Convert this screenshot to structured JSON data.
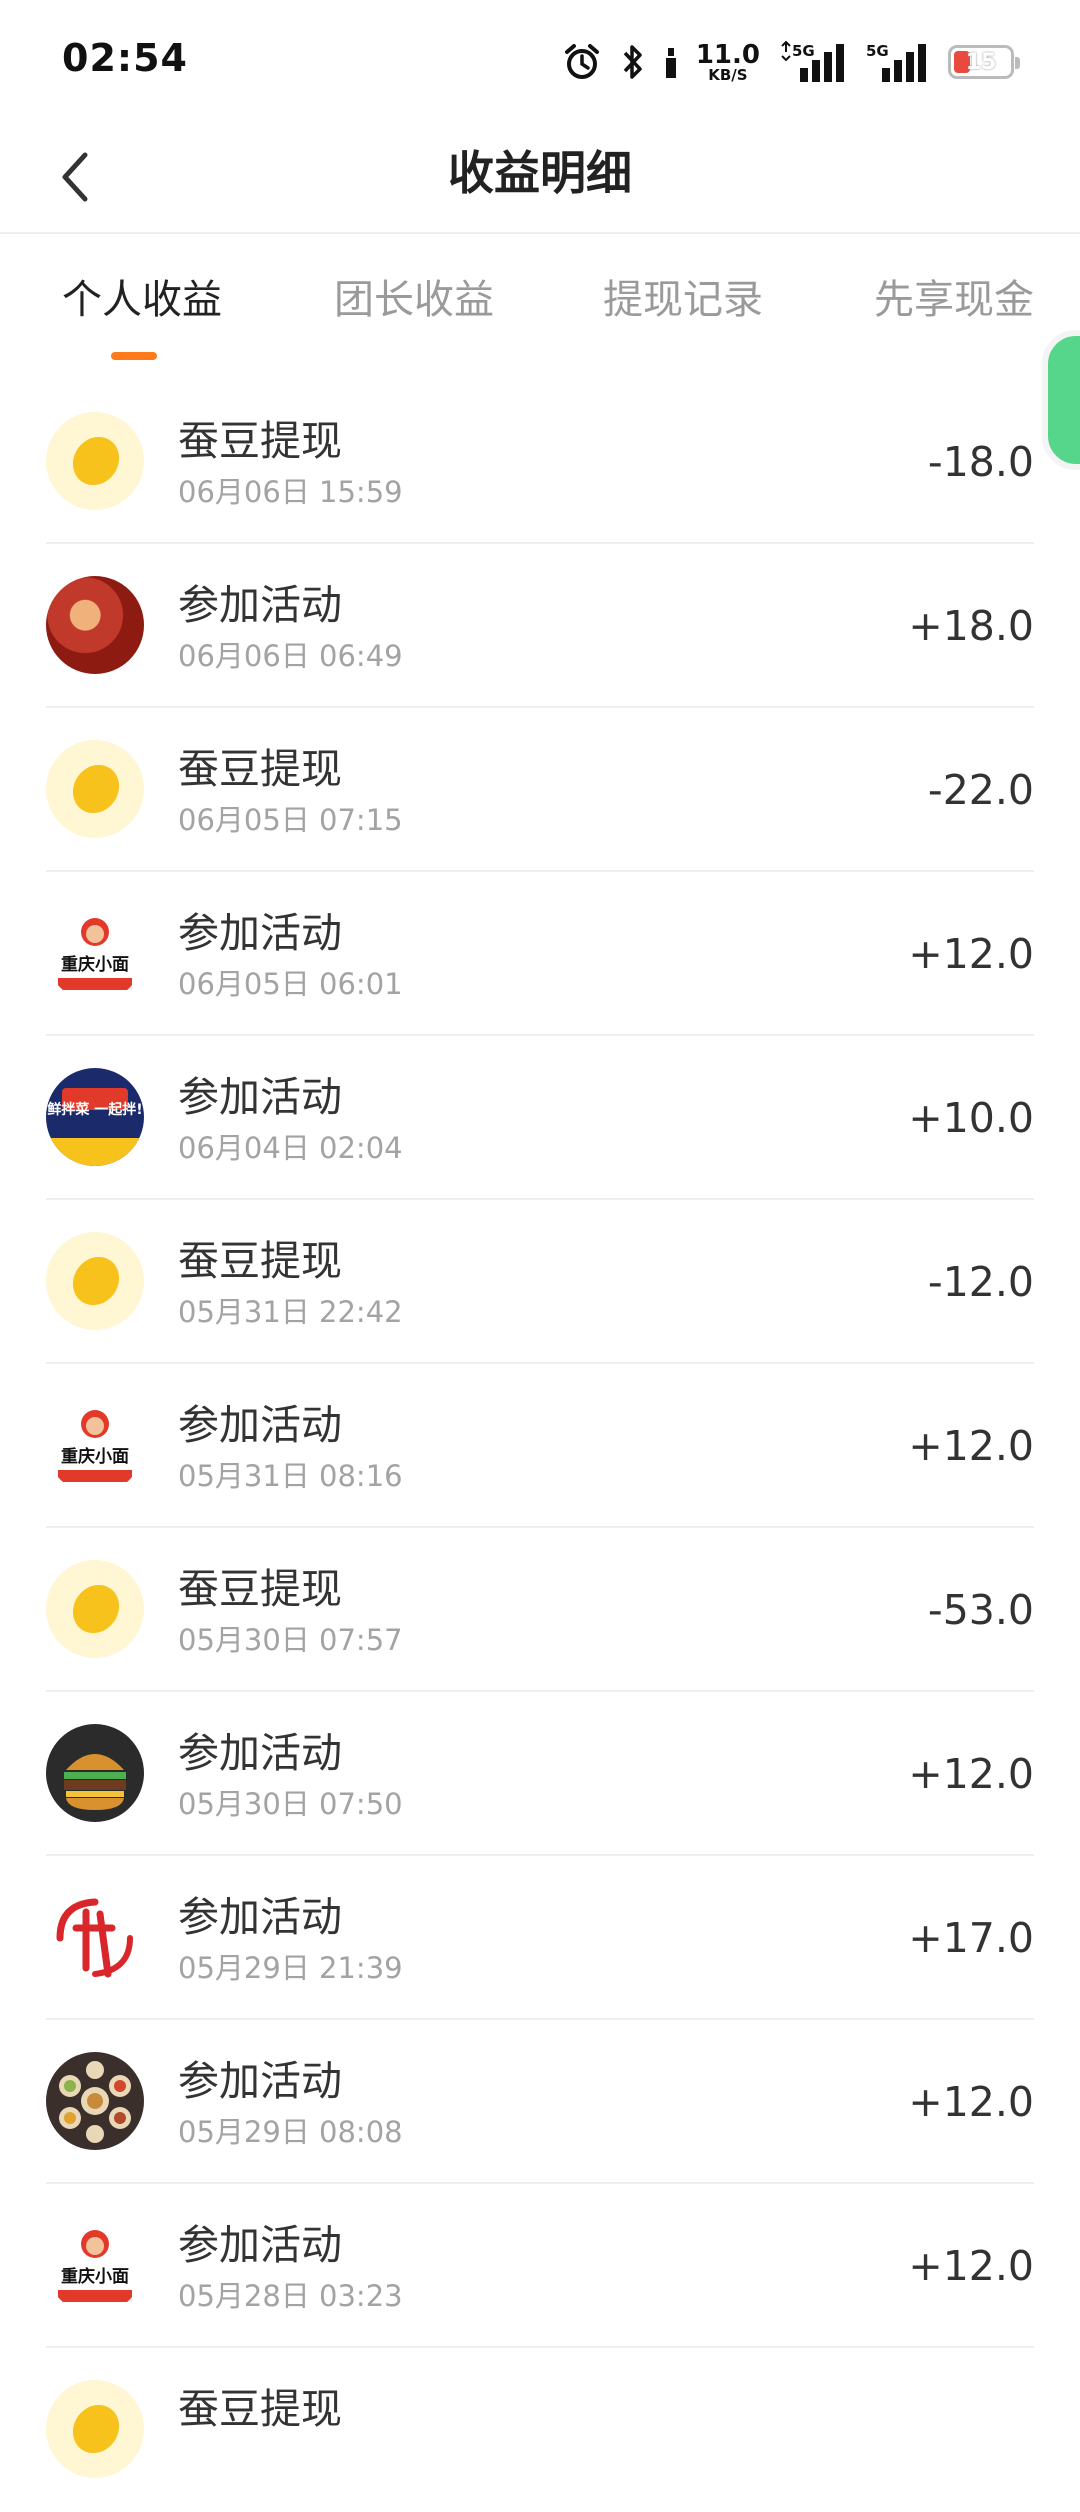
{
  "status_bar": {
    "time": "02:54",
    "net_speed_value": "11.0",
    "net_speed_unit": "KB/S",
    "signal_1_label": "5G",
    "signal_2_label": "5G",
    "battery_level": "15"
  },
  "header": {
    "title": "收益明细"
  },
  "tabs": [
    {
      "label": "个人收益",
      "active": true
    },
    {
      "label": "团长收益",
      "active": false
    },
    {
      "label": "提现记录",
      "active": false
    },
    {
      "label": "先享现金",
      "active": false
    }
  ],
  "records": [
    {
      "title": "蚕豆提现",
      "time": "06月06日 15:59",
      "amount": "-18.0",
      "avatar": "bean"
    },
    {
      "title": "参加活动",
      "time": "06月06日 06:49",
      "amount": "+18.0",
      "avatar": "food1"
    },
    {
      "title": "蚕豆提现",
      "time": "06月05日 07:15",
      "amount": "-22.0",
      "avatar": "bean"
    },
    {
      "title": "参加活动",
      "time": "06月05日 06:01",
      "amount": "+12.0",
      "avatar": "cqxm",
      "avatar_text": "重庆小面"
    },
    {
      "title": "参加活动",
      "time": "06月04日 02:04",
      "amount": "+10.0",
      "avatar": "xbc",
      "avatar_text": "鲜拌菜 一起拌!"
    },
    {
      "title": "蚕豆提现",
      "time": "05月31日 22:42",
      "amount": "-12.0",
      "avatar": "bean"
    },
    {
      "title": "参加活动",
      "time": "05月31日 08:16",
      "amount": "+12.0",
      "avatar": "cqxm",
      "avatar_text": "重庆小面"
    },
    {
      "title": "蚕豆提现",
      "time": "05月30日 07:57",
      "amount": "-53.0",
      "avatar": "bean"
    },
    {
      "title": "参加活动",
      "time": "05月30日 07:50",
      "amount": "+12.0",
      "avatar": "burger"
    },
    {
      "title": "参加活动",
      "time": "05月29日 21:39",
      "amount": "+17.0",
      "avatar": "xw"
    },
    {
      "title": "参加活动",
      "time": "05月29日 08:08",
      "amount": "+12.0",
      "avatar": "plates"
    },
    {
      "title": "参加活动",
      "time": "05月28日 03:23",
      "amount": "+12.0",
      "avatar": "cqxm",
      "avatar_text": "重庆小面"
    },
    {
      "title": "蚕豆提现",
      "time": "",
      "amount": "",
      "avatar": "bean"
    }
  ]
}
